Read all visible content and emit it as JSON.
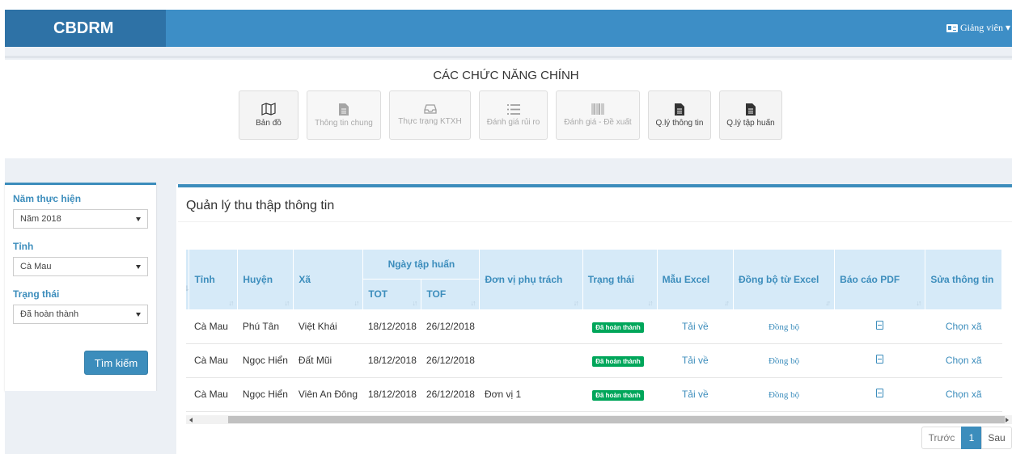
{
  "header": {
    "brand": "CBDRM",
    "user_label": "Giảng viên",
    "user_icon": "id-card-icon",
    "brand_color": "#2e72a6",
    "bar_color": "#3d8ec6"
  },
  "functions": {
    "title": "CÁC CHỨC NĂNG CHÍNH",
    "items": [
      {
        "label": "Bản đồ",
        "icon": "map-icon",
        "enabled": true
      },
      {
        "label": "Thông tin chung",
        "icon": "file-icon",
        "enabled": false
      },
      {
        "label": "Thực trạng KTXH",
        "icon": "inbox-icon",
        "enabled": false
      },
      {
        "label": "Đánh giá rủi ro",
        "icon": "list-icon",
        "enabled": false
      },
      {
        "label": "Đánh giá - Đề xuất",
        "icon": "barcode-icon",
        "enabled": false
      },
      {
        "label": "Q.lý thông tin",
        "icon": "file-icon",
        "enabled": true
      },
      {
        "label": "Q.lý tập huấn",
        "icon": "file-icon",
        "enabled": true
      }
    ]
  },
  "filter": {
    "year_label": "Năm thực hiện",
    "year_value": "Năm 2018",
    "province_label": "Tỉnh",
    "province_value": "Cà Mau",
    "status_label": "Trạng thái",
    "status_value": "Đã hoàn thành",
    "search_button": "Tìm kiếm"
  },
  "panel": {
    "title": "Quản lý thu thập thông tin"
  },
  "table": {
    "headers": {
      "province": "Tỉnh",
      "district": "Huyện",
      "commune": "Xã",
      "training_date": "Ngày tập huấn",
      "tot": "TOT",
      "tof": "TOF",
      "unit": "Đơn vị phụ trách",
      "status": "Trạng thái",
      "excel_template": "Mẫu Excel",
      "sync_excel": "Đồng bộ từ Excel",
      "pdf_report": "Báo cáo PDF",
      "edit_info": "Sửa thông tin"
    },
    "rows": [
      {
        "province": "Cà Mau",
        "district": "Phú Tân",
        "commune": "Việt Khái",
        "tot": "18/12/2018",
        "tof": "26/12/2018",
        "unit": "",
        "status": "Đã hoàn thành",
        "download": "Tải về",
        "sync": "Đồng bộ",
        "edit": "Chọn xã"
      },
      {
        "province": "Cà Mau",
        "district": "Ngọc Hiển",
        "commune": "Đất Mũi",
        "tot": "18/12/2018",
        "tof": "26/12/2018",
        "unit": "",
        "status": "Đã hoàn thành",
        "download": "Tải về",
        "sync": "Đồng bộ",
        "edit": "Chọn xã"
      },
      {
        "province": "Cà Mau",
        "district": "Ngọc Hiển",
        "commune": "Viên An Đông",
        "tot": "18/12/2018",
        "tof": "26/12/2018",
        "unit": "Đơn vị 1",
        "status": "Đã hoàn thành",
        "download": "Tải về",
        "sync": "Đồng bộ",
        "edit": "Chọn xã"
      }
    ],
    "status_color": "#00a65a",
    "accent_color": "#3c8dbc"
  },
  "pagination": {
    "prev": "Trước",
    "current": "1",
    "next": "Sau"
  }
}
